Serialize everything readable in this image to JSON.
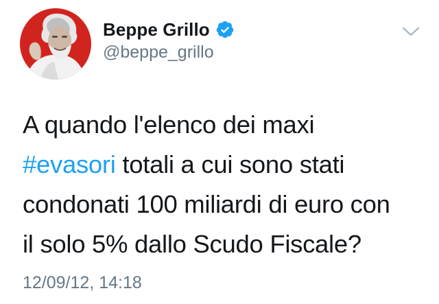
{
  "author": {
    "display_name": "Beppe Grillo",
    "handle": "@beppe_grillo",
    "verified": true,
    "avatar": "profile-photo"
  },
  "tweet": {
    "line1": "A quando l'elenco dei maxi",
    "hashtag": "#evasori",
    "line2_rest": " totali a cui sono stati",
    "line3": "condonati 100 miliardi di euro con",
    "line4": "il solo 5% dallo Scudo Fiscale?",
    "timestamp": "12/09/12, 14:18"
  },
  "icons": {
    "verified": "verified-badge-icon",
    "menu": "chevron-down-icon"
  },
  "colors": {
    "link": "#1da1f2",
    "secondary_text": "#657786",
    "primary_text": "#14171a",
    "avatar_background": "#d2241f"
  }
}
